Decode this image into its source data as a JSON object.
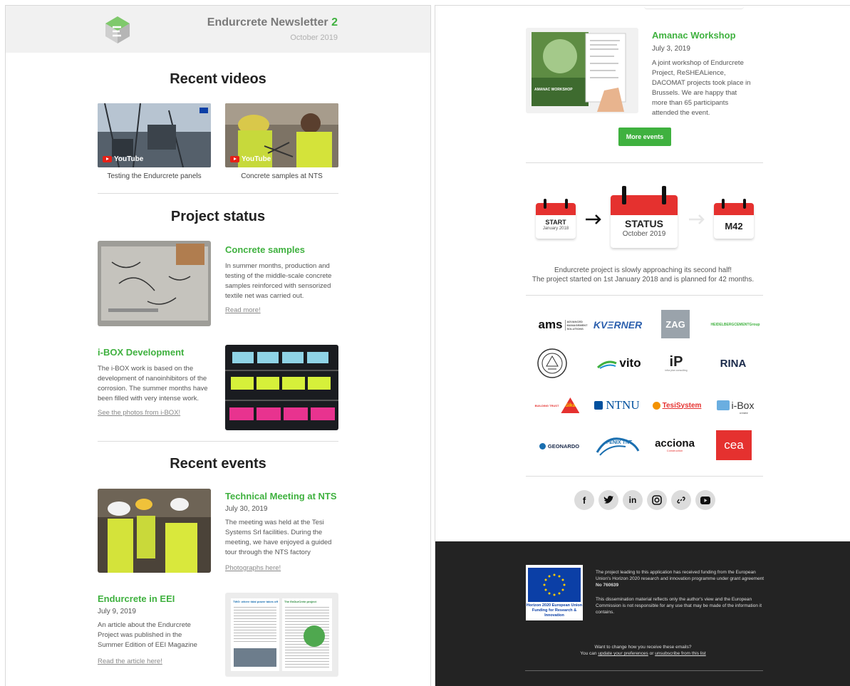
{
  "header": {
    "title": "Endurcrete Newsletter",
    "issue_number": "2",
    "date": "October 2019"
  },
  "videos": {
    "heading": "Recent videos",
    "items": [
      {
        "caption": "Testing the Endurcrete panels",
        "badge": "YouTube"
      },
      {
        "caption": "Concrete samples at NTS",
        "badge": "YouTube"
      }
    ]
  },
  "project_status": {
    "heading": "Project status",
    "concrete": {
      "title": "Concrete samples",
      "text": "In summer months, production and testing of the middle-scale concrete samples reinforced with sensorized textile net was carried out.",
      "link": "Read more!"
    },
    "ibox": {
      "title": "i-BOX Development",
      "text": "The i-BOX work is based on the development of nanoinhibitors of the corrosion. The summer months have been filled with very intense work.",
      "link": "See the photos from i-BOX!"
    }
  },
  "events": {
    "heading": "Recent events",
    "nts": {
      "title": "Technical Meeting at NTS",
      "date": "July 30, 2019",
      "text": "The meeting was held at the Tesi Systems Srl facilities. During the meeting, we have enjoyed a guided tour through the NTS factory",
      "link": "Photographs here!"
    },
    "eei": {
      "title": "Endurcrete in EEI",
      "date": "July 9, 2019",
      "text": "An article about the Endurcrete Project was published in the Summer Edition of EEI Magazine",
      "link": "Read the article here!",
      "magazine_left_headline": "TWG: where tidal power takes off",
      "magazine_right_headline": "The EnDurCrete project"
    },
    "amanac": {
      "title": "Amanac Workshop",
      "date": "July 3, 2019",
      "text": "A joint workshop of Endurcrete Project, ReSHEALience, DACOMAT projects took place in Brussels. We are happy that more than 65 participants attended the event.",
      "image_label": "AMANAC WORKSHOP"
    },
    "more_button": "More events"
  },
  "timeline": {
    "start": {
      "label": "START",
      "date": "January 2018"
    },
    "status": {
      "label": "STATUS",
      "date": "October 2019"
    },
    "end": {
      "label": "M42"
    },
    "text_line1": "Endurcrete project is slowly approaching its second half!",
    "text_line2": "The project started on 1st January 2018 and is planned for 42 months."
  },
  "partners": {
    "ams": "ams",
    "ams_tag": "ADVANCED MANAGEMENT SOLUTIONS",
    "kvaerner": "KVΞRNER",
    "zag": "ZAG",
    "heidelberg": "HEIDELBERGCEMENTGroup",
    "vito": "vito",
    "iip": "iP",
    "iip_tag": "infra plan consulting",
    "rina": "RINA",
    "sika_tag": "BUILDING TRUST",
    "sika": "Sika",
    "ntnu": "NTNU",
    "tecnosystem": "TesiSystem",
    "ibox": "i-Box",
    "ibox_tag": "create",
    "geonardo": "GEONARDO",
    "fenix": "FENIX TNT",
    "acciona": "acciona",
    "acciona_tag": "Construction",
    "cea": "cea"
  },
  "social": [
    "facebook-icon",
    "twitter-icon",
    "linkedin-icon",
    "instagram-icon",
    "link-icon",
    "youtube-icon"
  ],
  "footer": {
    "eu_label": "Horizon 2020 European Union Funding for Research & Innovation",
    "funding_pre": "The project leading to this application has received funding from the European Union's Horizon 2020 research and innovation programme under grant agreement",
    "grant_no": "No 760639",
    "disclaimer": "This dissemination material reflects only the author's view and the European Commission is not responsible for any use that may be made of the information it contains.",
    "prefs_q": "Want to change how you receive these emails?",
    "prefs_pre": "You can",
    "prefs_link": "update your preferences",
    "prefs_or": "or",
    "unsub_link": "unsubscribe from this list"
  },
  "colors": {
    "accent_green": "#3fb13f",
    "calendar_red": "#e5312f",
    "footer_bg": "#232323"
  }
}
